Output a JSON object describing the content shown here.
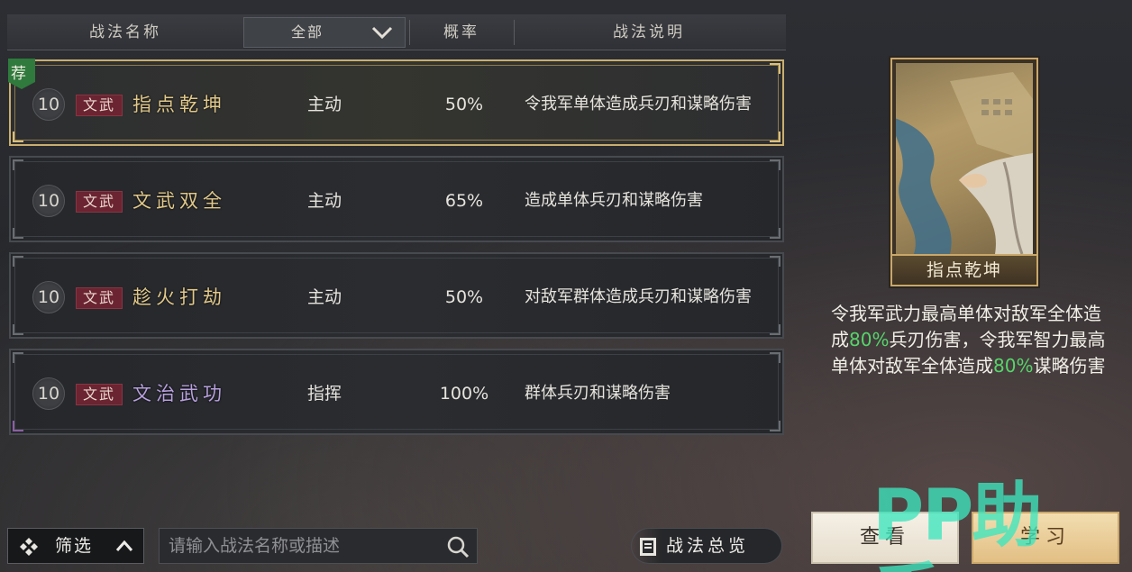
{
  "header": {
    "col_name": "战法名称",
    "col_filter": "全部",
    "col_prob": "概率",
    "col_desc": "战法说明"
  },
  "rows": [
    {
      "recommend": "荐",
      "level": "10",
      "type": "文武",
      "name": "指点乾坤",
      "kind": "主动",
      "prob": "50%",
      "desc": "令我军单体造成兵刃和谋略伤害",
      "name_color": "#e2c98a"
    },
    {
      "level": "10",
      "type": "文武",
      "name": "文武双全",
      "kind": "主动",
      "prob": "65%",
      "desc": "造成单体兵刃和谋略伤害",
      "name_color": "#e2c98a"
    },
    {
      "level": "10",
      "type": "文武",
      "name": "趁火打劫",
      "kind": "主动",
      "prob": "50%",
      "desc": "对敌军群体造成兵刃和谋略伤害",
      "name_color": "#e2c98a"
    },
    {
      "level": "10",
      "type": "文武",
      "name": "文治武功",
      "kind": "指挥",
      "prob": "100%",
      "desc": "群体兵刃和谋略伤害",
      "name_color": "#b9a1df"
    }
  ],
  "detail": {
    "card_name": "指点乾坤",
    "text_1": "令我军武力最高单体对敌军全体造成",
    "pct_1": "80%",
    "text_2": "兵刃伤害，令我军智力最高单体对敌军全体造成",
    "pct_2": "80%",
    "text_3": "谋略伤害",
    "highlight_color": "#57d46a"
  },
  "bottom": {
    "filter_label": "筛选",
    "search_placeholder": "请输入战法名称或描述",
    "overview_label": "战法总览",
    "view_button": "查看",
    "learn_button": "学习"
  },
  "watermark": "PP助手",
  "icons": [
    "chevron-down-icon",
    "recommend-badge-icon",
    "filter-icon",
    "chevron-up-icon",
    "search-icon",
    "book-icon"
  ]
}
